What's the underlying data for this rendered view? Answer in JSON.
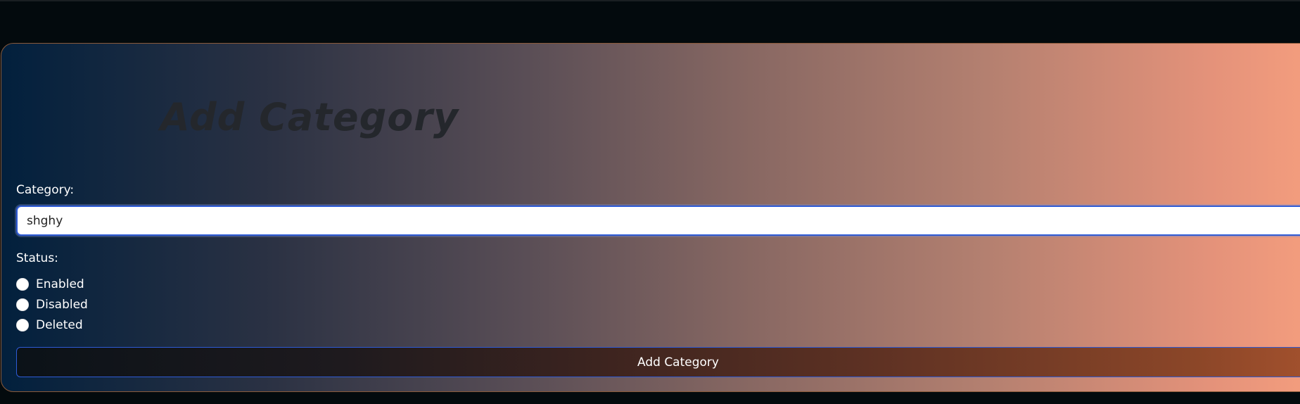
{
  "form": {
    "title": "Add Category",
    "category_label": "Category:",
    "category_value": "shghy",
    "status_label": "Status:",
    "status_options": [
      {
        "label": "Enabled"
      },
      {
        "label": "Disabled"
      },
      {
        "label": "Deleted"
      }
    ],
    "submit_label": "Add Category"
  },
  "colors": {
    "page_background": "#030a0d",
    "gradient_start": "#02203d",
    "gradient_end": "#f59e7e",
    "title_text": "#24272c",
    "input_border": "#2e5bd6",
    "button_gradient_start": "#0b1218",
    "button_gradient_end": "#a5522e"
  }
}
